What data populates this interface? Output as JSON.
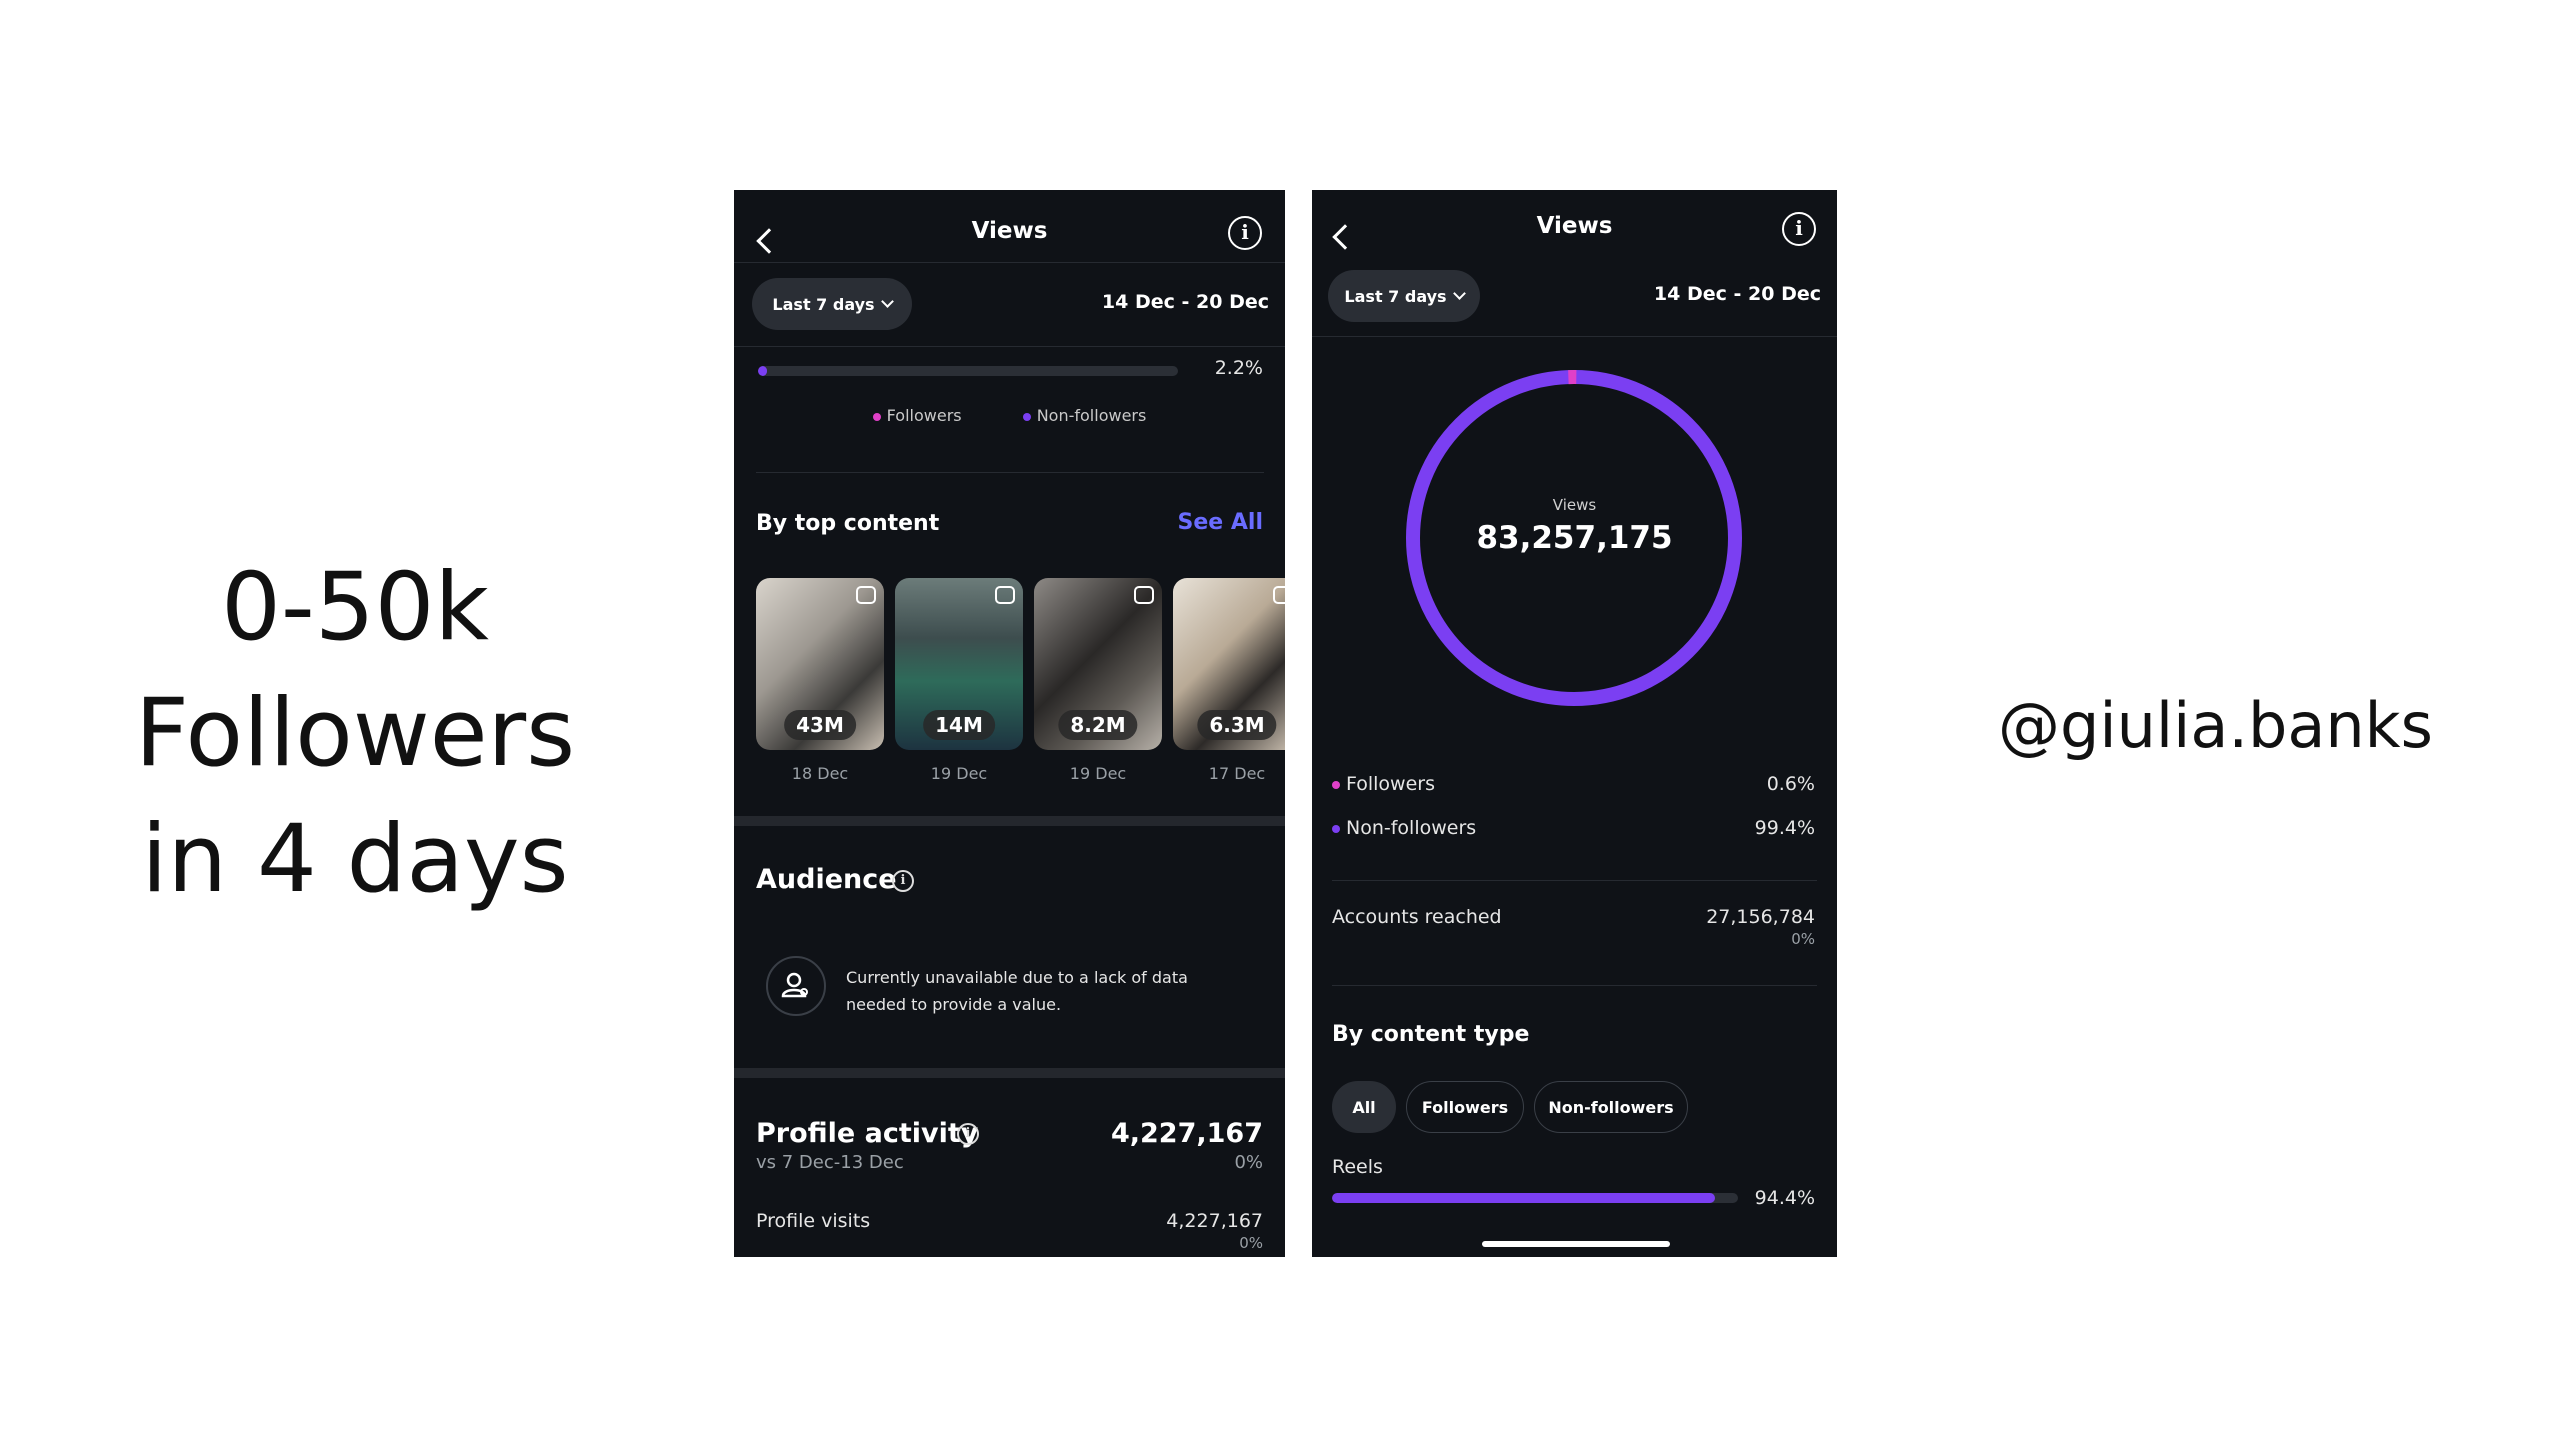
{
  "slide": {
    "headline_lines": [
      "0-50k",
      "Followers",
      "in 4 days"
    ],
    "handle": "@giulia.banks"
  },
  "colors": {
    "followers": "#e040c8",
    "non_followers": "#7b3ff2",
    "link": "#6a6cff",
    "background_dark": "#0f1217"
  },
  "left_screen": {
    "header": {
      "title": "Views",
      "back_icon": "chevron-left-icon",
      "info_icon": "info-icon"
    },
    "filter": {
      "label": "Last 7 days",
      "date_range": "14 Dec - 20 Dec"
    },
    "split_bar": {
      "followers_pct": 2.2,
      "label": "2.2%"
    },
    "legend": {
      "followers": "Followers",
      "non_followers": "Non-followers"
    },
    "top_content": {
      "title": "By top content",
      "see_all": "See All",
      "items": [
        {
          "views": "43M",
          "date": "18 Dec"
        },
        {
          "views": "14M",
          "date": "19 Dec"
        },
        {
          "views": "8.2M",
          "date": "19 Dec"
        },
        {
          "views": "6.3M",
          "date": "17 Dec"
        }
      ]
    },
    "audience": {
      "title": "Audience",
      "message": "Currently unavailable due to a lack of data needed to provide a value."
    },
    "profile_activity": {
      "title": "Profile activity",
      "comparison": "vs 7 Dec-13 Dec",
      "value": "4,227,167",
      "change": "0%",
      "visits_label": "Profile visits",
      "visits_value": "4,227,167",
      "visits_change": "0%"
    }
  },
  "right_screen": {
    "header": {
      "title": "Views",
      "back_icon": "chevron-left-icon",
      "info_icon": "info-icon"
    },
    "filter": {
      "label": "Last 7 days",
      "date_range": "14 Dec - 20 Dec"
    },
    "donut": {
      "label": "Views",
      "value": "83,257,175",
      "followers_pct": 0.6
    },
    "breakdown": [
      {
        "label": "Followers",
        "value": "0.6%"
      },
      {
        "label": "Non-followers",
        "value": "99.4%"
      }
    ],
    "accounts_reached": {
      "label": "Accounts reached",
      "value": "27,156,784",
      "change": "0%"
    },
    "content_type": {
      "title": "By content type",
      "chips": [
        "All",
        "Followers",
        "Non-followers"
      ],
      "selected": "All",
      "reels": {
        "label": "Reels",
        "pct": 94.4,
        "value": "94.4%"
      }
    }
  }
}
